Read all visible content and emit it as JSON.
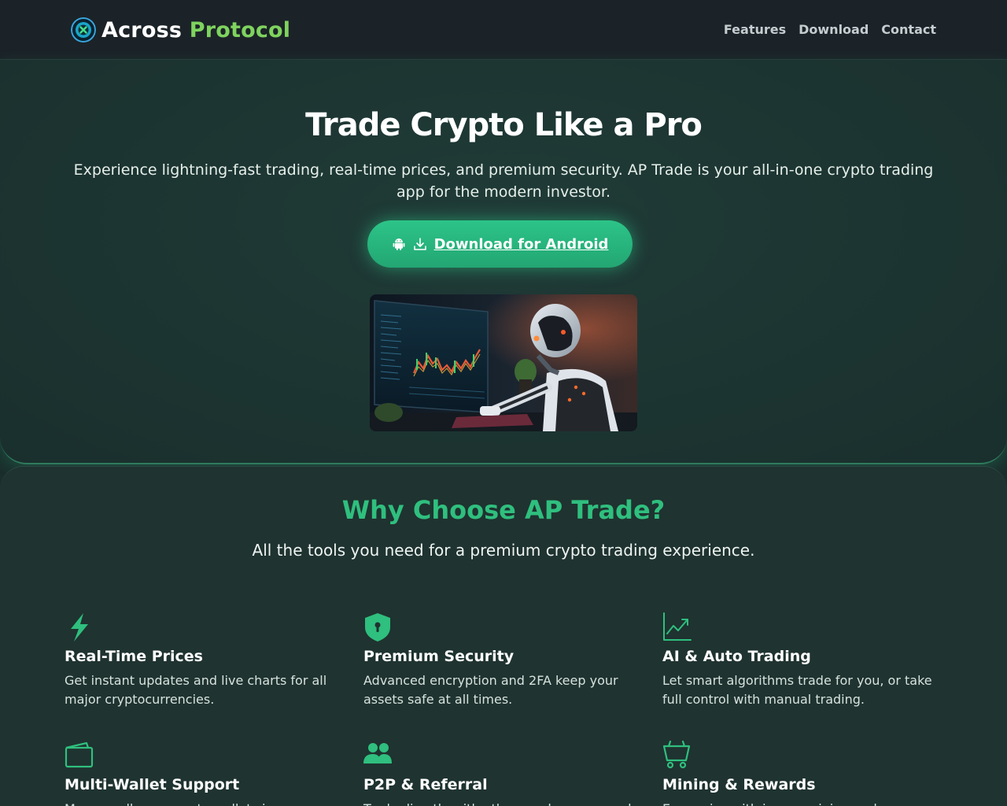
{
  "header": {
    "brand_part1": "Across",
    "brand_part2": "Protocol",
    "logo_icon": "across-protocol-logo",
    "nav": [
      "Features",
      "Download",
      "Contact"
    ]
  },
  "hero": {
    "title": "Trade Crypto Like a Pro",
    "subtitle": "Experience lightning-fast trading, real-time prices, and premium security. AP Trade is your all-in-one crypto trading app for the modern investor.",
    "cta_label": "Download for Android",
    "cta_icons": [
      "android-icon",
      "download-icon"
    ],
    "image_alt": "robot-trading-chart-image"
  },
  "features": {
    "title": "Why Choose AP Trade?",
    "subtitle": "All the tools you need for a premium crypto trading experience.",
    "cards": [
      {
        "icon": "lightning-icon",
        "title": "Real-Time Prices",
        "desc": "Get instant updates and live charts for all major cryptocurrencies."
      },
      {
        "icon": "shield-icon",
        "title": "Premium Security",
        "desc": "Advanced encryption and 2FA keep your assets safe at all times."
      },
      {
        "icon": "chart-line-icon",
        "title": "AI & Auto Trading",
        "desc": "Let smart algorithms trade for you, or take full control with manual trading."
      },
      {
        "icon": "wallet-icon",
        "title": "Multi-Wallet Support",
        "desc": "Manage all your crypto wallets in one"
      },
      {
        "icon": "users-icon",
        "title": "P2P & Referral",
        "desc": "Trade directly with others and earn rewards"
      },
      {
        "icon": "cart-icon",
        "title": "Mining & Rewards",
        "desc": "Earn coins with in-app mining and exclusive"
      }
    ]
  },
  "colors": {
    "accent": "#2fbf7e",
    "brand_green": "#7fd35e",
    "cta": "#2cc488",
    "background": "#1a2e2c"
  }
}
